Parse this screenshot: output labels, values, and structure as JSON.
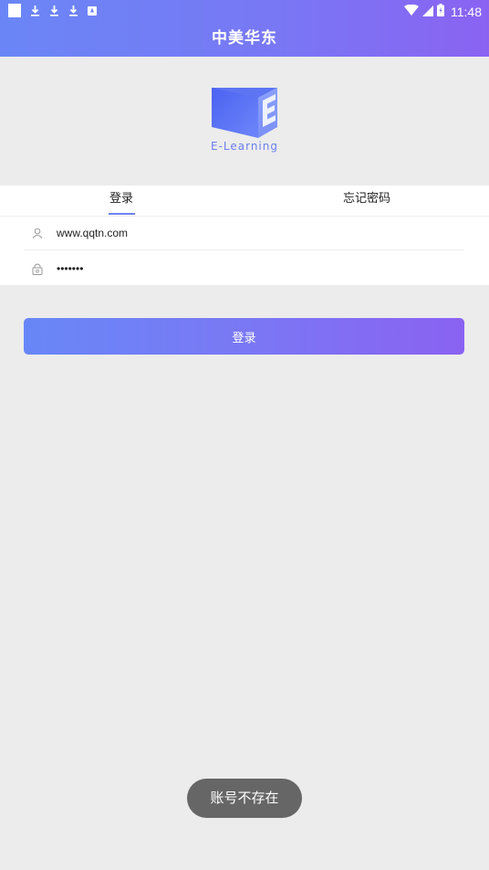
{
  "status_bar": {
    "left_icons": [
      "notification-square-icon",
      "download-icon",
      "download-icon",
      "download-icon",
      "a-notification-icon"
    ],
    "right_icons": [
      "wifi-icon",
      "cellular-signal-icon",
      "battery-charging-icon"
    ],
    "time": "11:48"
  },
  "header": {
    "title": "中美华东"
  },
  "logo": {
    "text": "E-Learning"
  },
  "tabs": [
    {
      "label": "登录",
      "active": true
    },
    {
      "label": "忘记密码",
      "active": false
    }
  ],
  "form": {
    "username": {
      "value": "www.qqtn.com",
      "icon": "user-icon"
    },
    "password": {
      "value": "•••••••",
      "icon": "lock-icon"
    }
  },
  "login_button": {
    "label": "登录"
  },
  "toast": {
    "message": "账号不存在"
  },
  "colors": {
    "gradient_start": "#6a86f6",
    "gradient_end": "#8a63f2",
    "accent": "#6e82f4",
    "background": "#ececec",
    "toast_bg": "#666666"
  }
}
